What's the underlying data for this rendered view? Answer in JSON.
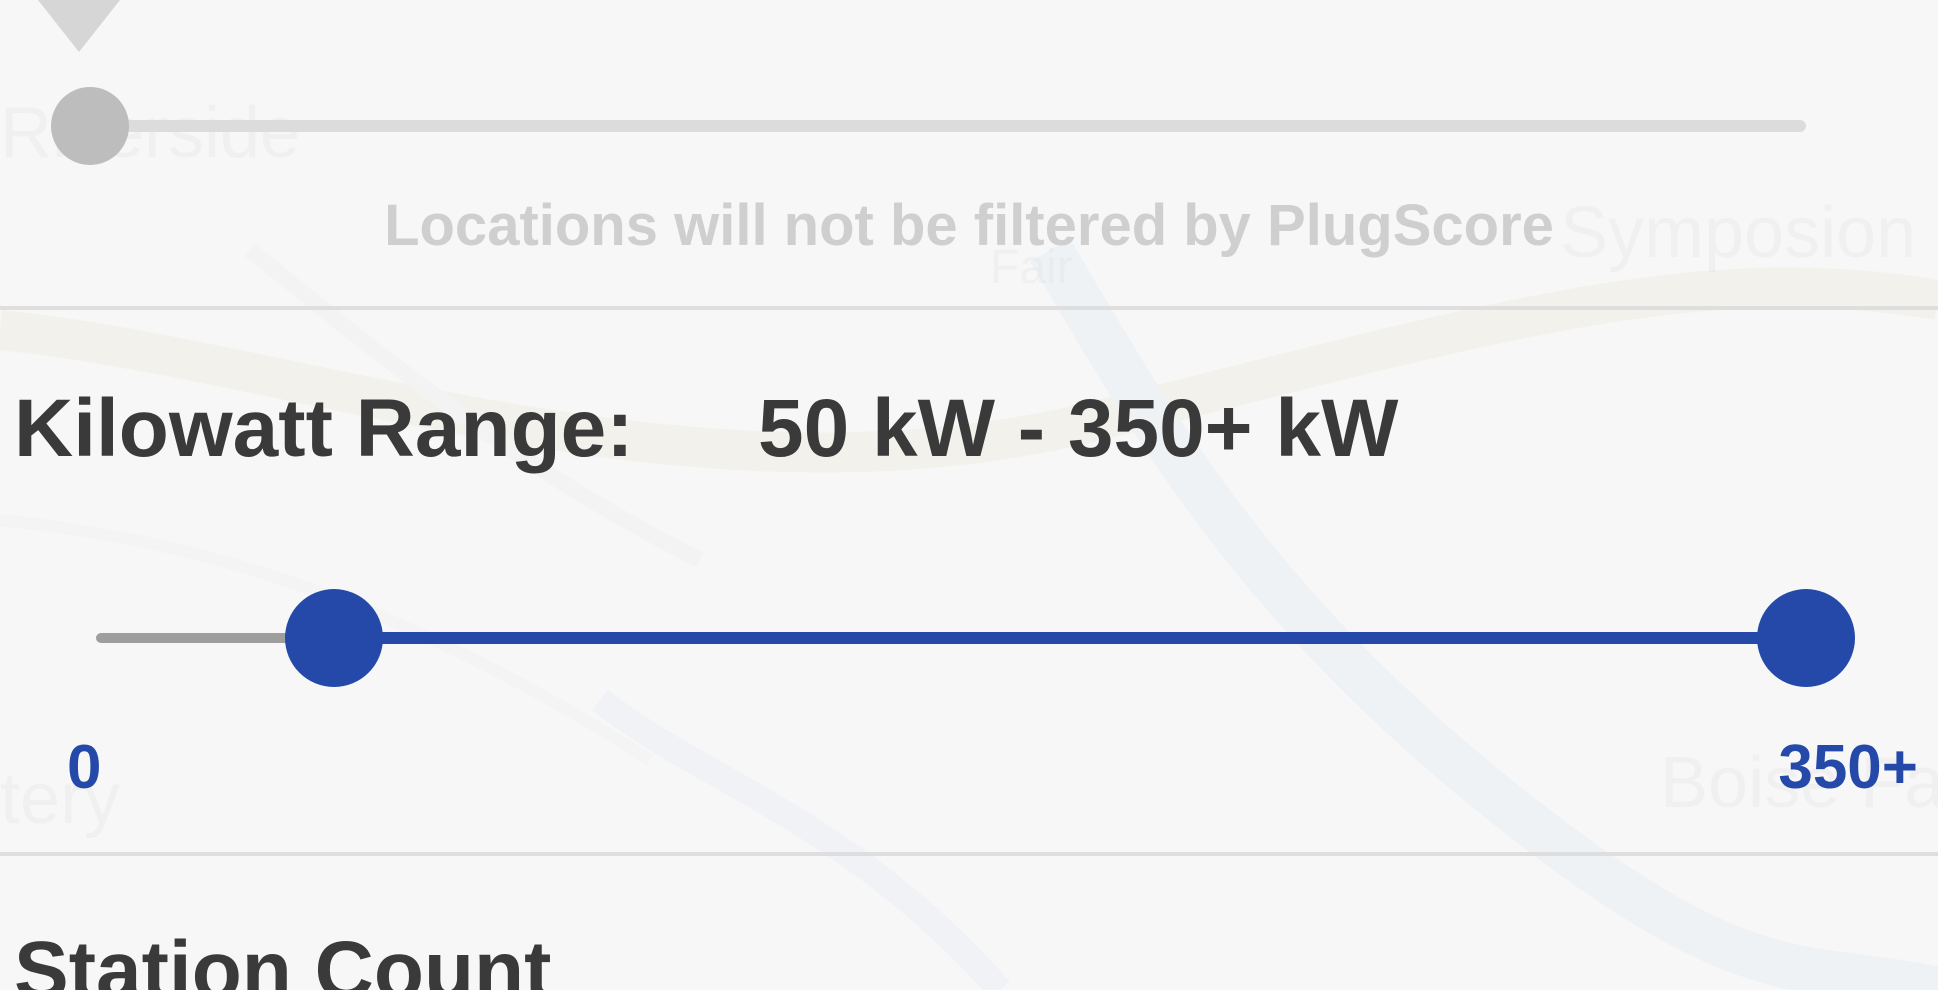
{
  "plugscore": {
    "note": "Locations will not be filtered by PlugScore",
    "enabled": false
  },
  "kilowatt": {
    "title": "Kilowatt Range:",
    "value": "50 kW - 350+ kW",
    "min_label": "0",
    "max_label": "350+",
    "selected_min": 50,
    "selected_max": 350,
    "range_max": 350,
    "accent_color": "#2549a8"
  },
  "station_count": {
    "title": "Station Count"
  },
  "map_labels": [
    "Riverside",
    "Symposion",
    "Boise Fa",
    "tery",
    "Fair"
  ],
  "icons": {
    "plugscore_pin": "map-pin-icon"
  }
}
